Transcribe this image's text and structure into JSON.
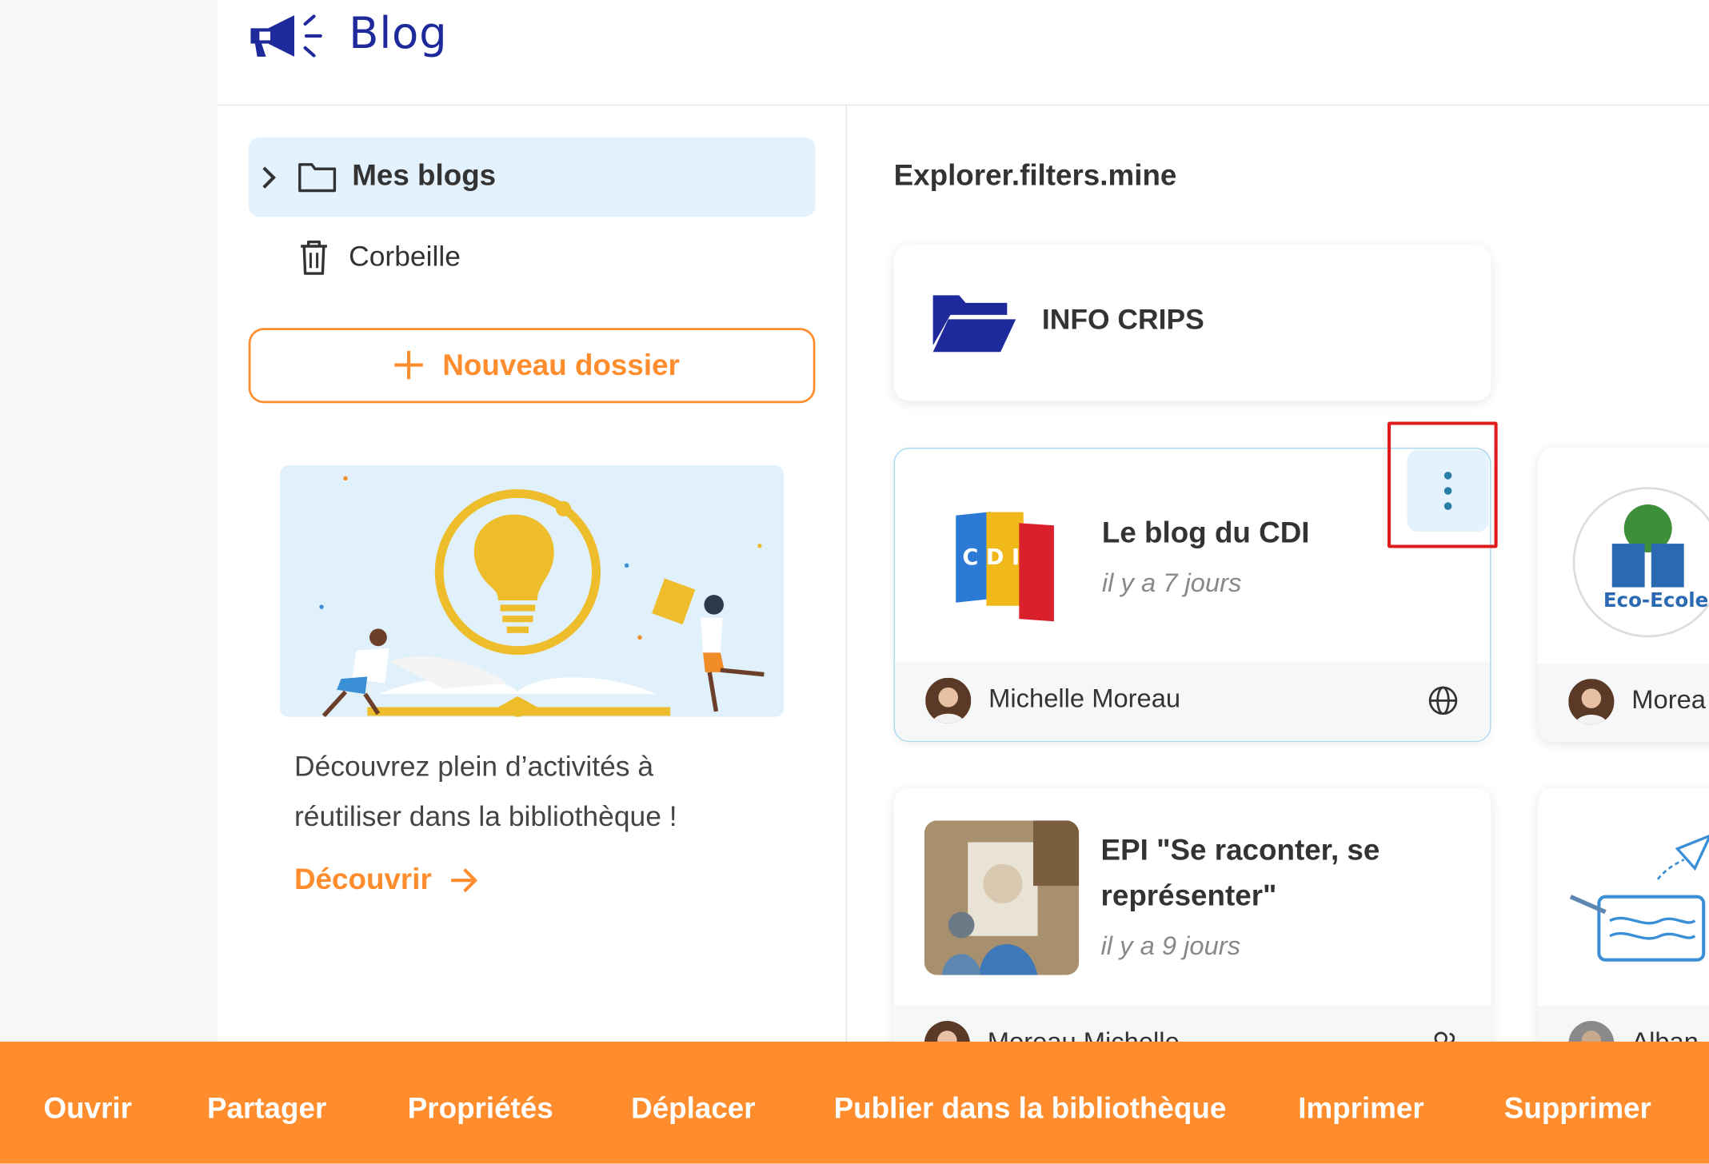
{
  "app": {
    "title": "Blog"
  },
  "sidebar": {
    "tree_root": "Mes blogs",
    "trash": "Corbeille",
    "new_folder": "Nouveau dossier",
    "promo_text": "Découvrez plein d’activités à réutiliser dans la bibliothèque !",
    "promo_link": "Découvrir"
  },
  "main": {
    "filter_title": "Explorer.filters.mine",
    "folder": {
      "name": "INFO CRIPS"
    },
    "cards": [
      {
        "title": "Le blog du CDI",
        "date": "il y a 7 jours",
        "author": "Michelle Moreau",
        "visibility_icon": "globe-icon",
        "thumb_text": "C D I"
      },
      {
        "title": "",
        "author": "Morea",
        "thumb_text": "Eco-Ecole"
      },
      {
        "title": "EPI \"Se raconter, se représenter\"",
        "date": "il y a 9 jours",
        "author": "Moreau Michelle",
        "visibility_icon": "users-icon"
      },
      {
        "title": "",
        "author": "Alban"
      }
    ]
  },
  "action_bar": {
    "buttons": [
      "Ouvrir",
      "Partager",
      "Propriétés",
      "Déplacer",
      "Publier dans la bibliothèque",
      "Imprimer",
      "Supprimer"
    ]
  },
  "colors": {
    "accent": "#ff8d2e",
    "brand": "#1e2a9c",
    "selected_bg": "#e3f2fc",
    "highlight": "#e11b1b"
  }
}
